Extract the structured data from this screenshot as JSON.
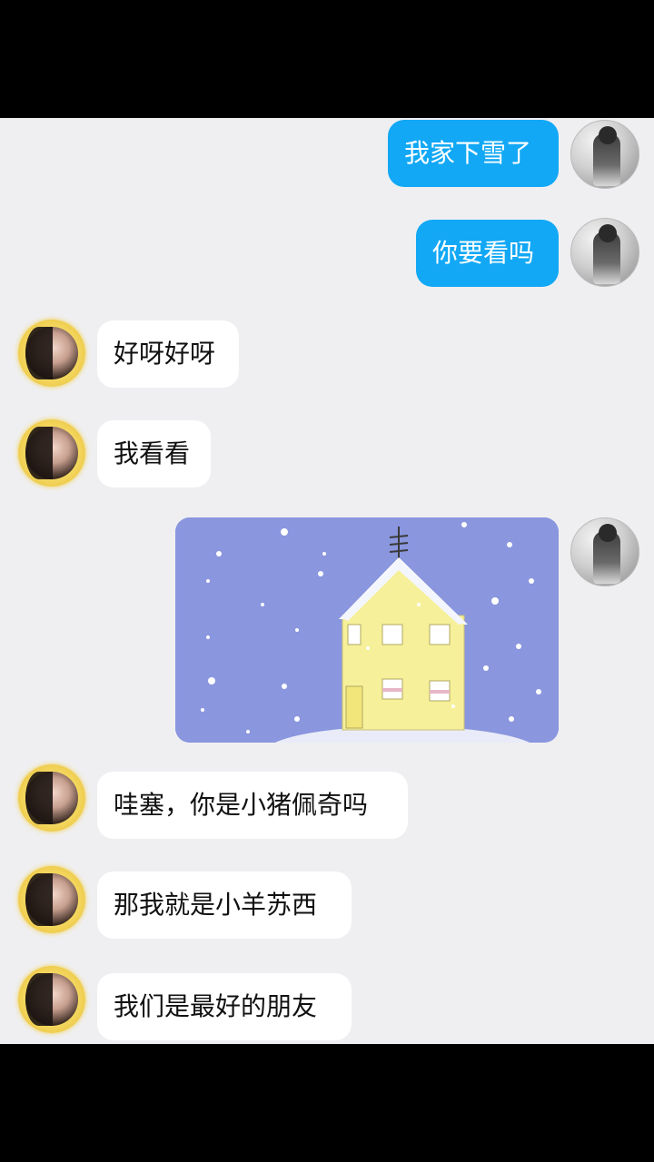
{
  "messages": [
    {
      "side": "out",
      "text": "我家下雪了"
    },
    {
      "side": "out",
      "text": "你要看吗"
    },
    {
      "side": "in",
      "text": "好呀好呀"
    },
    {
      "side": "in",
      "text": "我看看"
    },
    {
      "side": "out",
      "type": "image",
      "image": "snowy-house-illustration"
    },
    {
      "side": "in",
      "text": "哇塞，你是小猪佩奇吗"
    },
    {
      "side": "in",
      "text": "那我就是小羊苏西"
    },
    {
      "side": "in",
      "text": "我们是最好的朋友"
    }
  ],
  "colors": {
    "outgoing_bubble": "#12a8f5",
    "incoming_bubble": "#ffffff",
    "chat_background": "#efeff2",
    "photo_sky": "#8a96de",
    "house": "#f6f09a"
  }
}
